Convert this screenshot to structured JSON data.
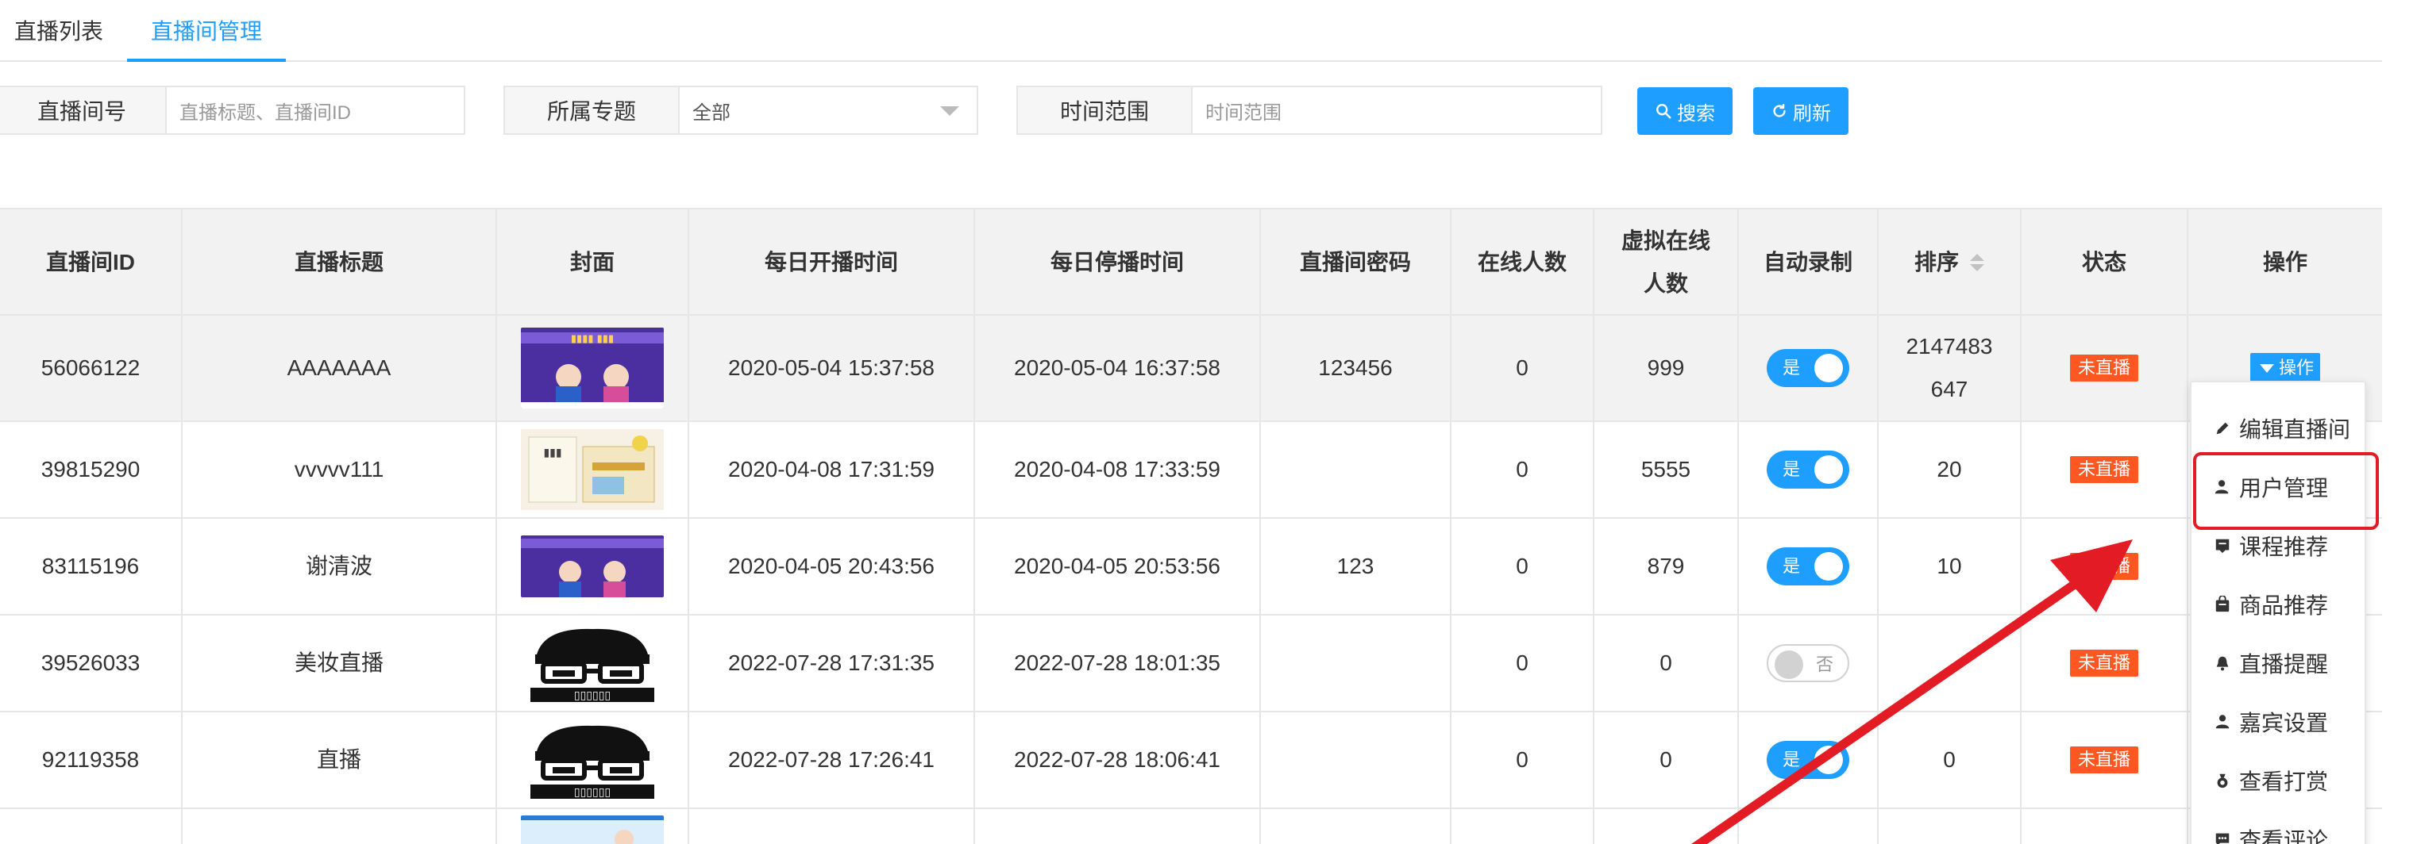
{
  "tabs": [
    {
      "label": "直播列表"
    },
    {
      "label": "直播间管理"
    }
  ],
  "filters": {
    "room_label": "直播间号",
    "room_placeholder": "直播标题、直播间ID",
    "topic_label": "所属专题",
    "topic_value": "全部",
    "time_label": "时间范围",
    "time_placeholder": "时间范围",
    "search_button": "搜索",
    "refresh_button": "刷新"
  },
  "table": {
    "headers": {
      "id": "直播间ID",
      "title": "直播标题",
      "cover": "封面",
      "start": "每日开播时间",
      "stop": "每日停播时间",
      "password": "直播间密码",
      "online": "在线人数",
      "virtual_line1": "虚拟在线",
      "virtual_line2": "人数",
      "record": "自动录制",
      "sort": "排序",
      "status": "状态",
      "action": "操作"
    },
    "rows": [
      {
        "id": "56066122",
        "title": "AAAAAAA",
        "cover": "poster-purple",
        "start": "2020-05-04 15:37:58",
        "stop": "2020-05-04 16:37:58",
        "password": "123456",
        "online": "0",
        "virtual": "999",
        "record": "是",
        "record_on": true,
        "sort_line1": "2147483",
        "sort_line2": "647",
        "status": "未直播",
        "action": "操作"
      },
      {
        "id": "39815290",
        "title": "vvvvv111",
        "cover": "book-cover",
        "start": "2020-04-08 17:31:59",
        "stop": "2020-04-08 17:33:59",
        "password": "",
        "online": "0",
        "virtual": "5555",
        "record": "是",
        "record_on": true,
        "sort": "20",
        "status": "未直播"
      },
      {
        "id": "83115196",
        "title": "谢清波",
        "cover": "poster-purple",
        "start": "2020-04-05 20:43:56",
        "stop": "2020-04-05 20:53:56",
        "password": "123",
        "online": "0",
        "virtual": "879",
        "record": "是",
        "record_on": true,
        "sort": "10",
        "status": "未直播"
      },
      {
        "id": "39526033",
        "title": "美妆直播",
        "cover": "glasses-logo",
        "start": "2022-07-28 17:31:35",
        "stop": "2022-07-28 18:01:35",
        "password": "",
        "online": "0",
        "virtual": "0",
        "record": "否",
        "record_on": false,
        "sort": "",
        "status": "未直播"
      },
      {
        "id": "92119358",
        "title": "直播",
        "cover": "glasses-logo",
        "start": "2022-07-28 17:26:41",
        "stop": "2022-07-28 18:06:41",
        "password": "",
        "online": "0",
        "virtual": "0",
        "record": "是",
        "record_on": true,
        "sort": "0",
        "status": "未直播"
      }
    ]
  },
  "dropdown": {
    "items": [
      {
        "label": "编辑直播间",
        "icon": "pencil-icon"
      },
      {
        "label": "用户管理",
        "icon": "user-icon"
      },
      {
        "label": "课程推荐",
        "icon": "course-icon"
      },
      {
        "label": "商品推荐",
        "icon": "goods-icon"
      },
      {
        "label": "直播提醒",
        "icon": "bell-icon"
      },
      {
        "label": "嘉宾设置",
        "icon": "guest-icon"
      },
      {
        "label": "查看打赏",
        "icon": "reward-icon"
      },
      {
        "label": "查看评论",
        "icon": "comment-icon"
      }
    ]
  },
  "colors": {
    "accent": "#1e9fff",
    "status_badge": "#ff5722",
    "annotation_red": "#e21b24"
  }
}
